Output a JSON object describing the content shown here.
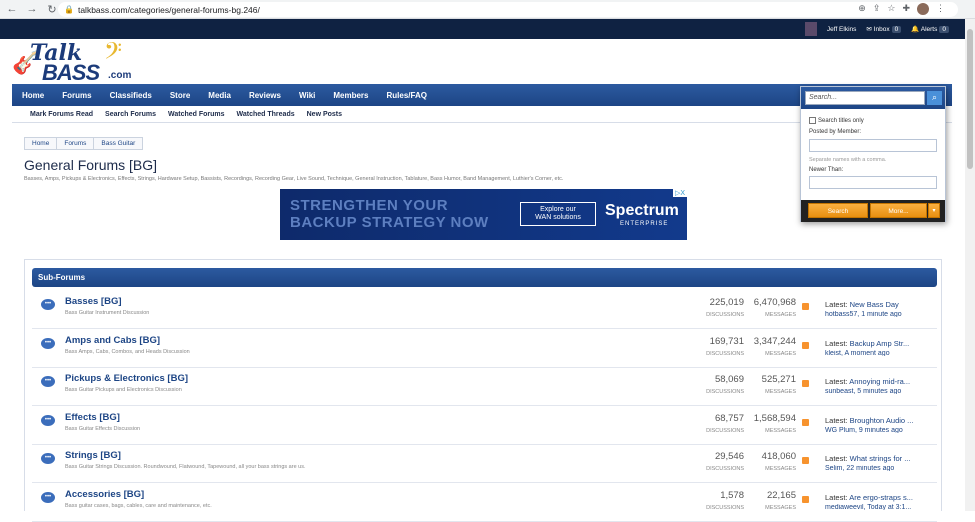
{
  "browser": {
    "url": "talkbass.com/categories/general-forums-bg.246/"
  },
  "topbar": {
    "user": "Jeff Elkins",
    "inbox_label": "Inbox",
    "inbox_count": "0",
    "alerts_label": "Alerts",
    "alerts_count": "0"
  },
  "logo": {
    "talk": "Talk",
    "bass": "BASS",
    "com": ".com"
  },
  "nav": [
    "Home",
    "Forums",
    "Classifieds",
    "Store",
    "Media",
    "Reviews",
    "Wiki",
    "Members",
    "Rules/FAQ"
  ],
  "subnav": [
    "Mark Forums Read",
    "Search Forums",
    "Watched Forums",
    "Watched Threads",
    "New Posts"
  ],
  "breadcrumb": [
    "Home",
    "Forums",
    "Bass Guitar"
  ],
  "page": {
    "title": "General Forums [BG]",
    "description": "Basses, Amps, Pickups & Electronics, Effects, Strings, Hardware Setup, Bassists, Recordings, Recording Gear, Live Sound, Technique, General Instruction, Tablature, Bass Humor, Band Management, Luthier's Corner, etc."
  },
  "ad": {
    "line1": "STRENGTHEN YOUR",
    "line2": "BACKUP STRATEGY NOW",
    "cta_line1": "Explore our",
    "cta_line2": "WAN solutions",
    "brand": "Spectrum",
    "brand_sub": "ENTERPRISE",
    "marker": "▷X"
  },
  "subforums": {
    "header": "Sub-Forums",
    "discussions_label": "DISCUSSIONS",
    "messages_label": "MESSAGES",
    "latest_prefix": "Latest:",
    "rows": [
      {
        "name": "Basses [BG]",
        "desc": "Bass Guitar Instrument Discussion",
        "discussions": "225,019",
        "messages": "6,470,968",
        "latest": "New Bass Day",
        "who": "hotbass57, 1 minute ago"
      },
      {
        "name": "Amps and Cabs [BG]",
        "desc": "Bass Amps, Cabs, Combos, and Heads Discussion",
        "discussions": "169,731",
        "messages": "3,347,244",
        "latest": "Backup Amp Str...",
        "who": "kleist, A moment ago"
      },
      {
        "name": "Pickups & Electronics [BG]",
        "desc": "Bass Guitar Pickups and Electronics Discussion",
        "discussions": "58,069",
        "messages": "525,271",
        "latest": "Annoying mid-ra...",
        "who": "sunbeast, 5 minutes ago"
      },
      {
        "name": "Effects [BG]",
        "desc": "Bass Guitar Effects Discussion",
        "discussions": "68,757",
        "messages": "1,568,594",
        "latest": "Broughton Audio ...",
        "who": "WG Plum, 9 minutes ago"
      },
      {
        "name": "Strings [BG]",
        "desc": "Bass Guitar Strings Discussion. Roundwound, Flatwound, Tapewound, all your bass strings are us.",
        "discussions": "29,546",
        "messages": "418,060",
        "latest": "What strings for ...",
        "who": "Selim, 22 minutes ago"
      },
      {
        "name": "Accessories [BG]",
        "desc": "Bass guitar cases, bags, cables, care and maintenance, etc.",
        "discussions": "1,578",
        "messages": "22,165",
        "latest": "Are ergo-straps s...",
        "who": "mediaweevil, Today at 3:1..."
      }
    ]
  },
  "search": {
    "placeholder": "Search...",
    "titles_only": "Search titles only",
    "posted_by": "Posted by Member:",
    "hint": "Separate names with a comma.",
    "newer_than": "Newer Than:",
    "search_btn": "Search",
    "more_btn": "More..."
  }
}
